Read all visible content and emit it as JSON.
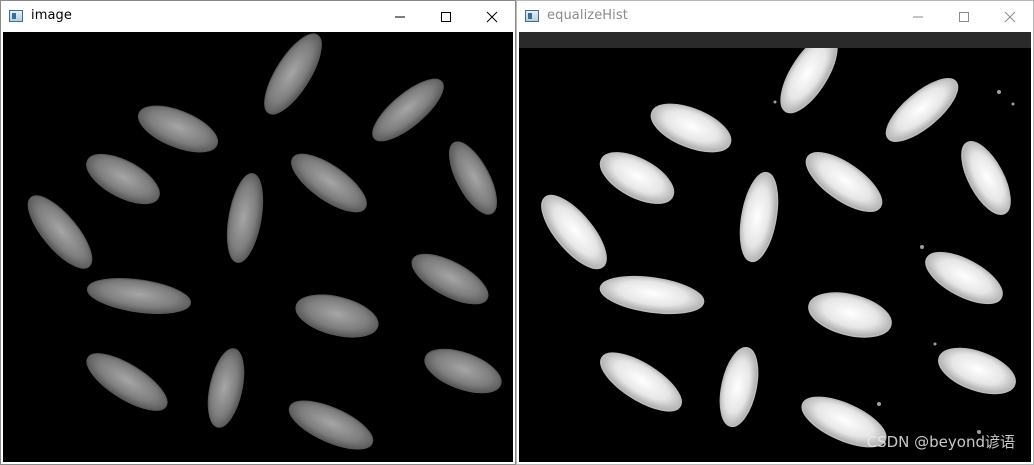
{
  "windows": {
    "left": {
      "title": "image"
    },
    "right": {
      "title": "equalizeHist"
    }
  },
  "icons": {
    "app": "app-icon",
    "minimize": "minimize-icon",
    "maximize": "maximize-icon",
    "close": "close-icon"
  },
  "watermark": "CSDN @beyond谚语",
  "colors": {
    "titlebar": "#ffffff",
    "image_bg": "#000000",
    "inactive_title": "#8a8a8a"
  }
}
